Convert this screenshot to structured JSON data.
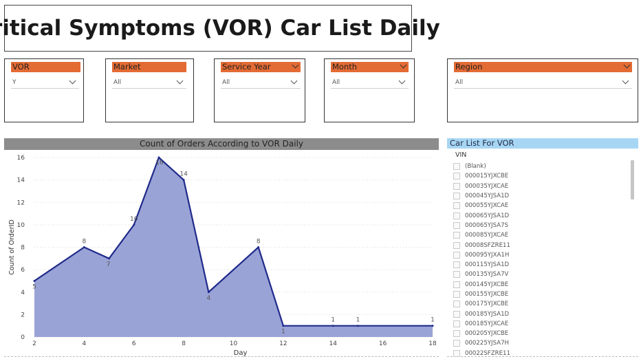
{
  "page": {
    "title": "Critical Symptoms (VOR) Car List Daily"
  },
  "slicers": [
    {
      "label": "VOR",
      "value": "Y",
      "header_chevron": false
    },
    {
      "label": "Market",
      "value": "All",
      "header_chevron": false
    },
    {
      "label": "Service Year",
      "value": "All",
      "header_chevron": true
    },
    {
      "label": "Month",
      "value": "All",
      "header_chevron": true
    },
    {
      "label": "Region",
      "value": "All",
      "header_chevron": true
    }
  ],
  "colors": {
    "header_orange": "#e36b34",
    "area_fill": "#9aa3d6",
    "area_line": "#1f2a8a",
    "list_title": "#a7d6f4"
  },
  "chart": {
    "title": "Count of Orders According to VOR Daily"
  },
  "chart_data": {
    "type": "area",
    "title": "Count of Orders According to VOR Daily",
    "xlabel": "Day",
    "ylabel": "Count of OrderID",
    "x": [
      2,
      4,
      5,
      6,
      7,
      8,
      9,
      11,
      12,
      14,
      15,
      18
    ],
    "y": [
      5,
      8,
      7,
      10,
      16,
      14,
      4,
      8,
      1,
      1,
      1,
      1
    ],
    "data_labels": [
      "5",
      "8",
      "7",
      "10",
      "16",
      "14",
      "4",
      "8",
      "1",
      "1",
      "1",
      "1"
    ],
    "xlim": [
      2,
      18
    ],
    "ylim": [
      0,
      16
    ],
    "xticks": [
      "2",
      "4",
      "6",
      "8",
      "10",
      "12",
      "14",
      "16",
      "18"
    ],
    "yticks": [
      "0",
      "2",
      "4",
      "6",
      "8",
      "10",
      "12",
      "14",
      "16"
    ],
    "grid": true
  },
  "car_list": {
    "title": "Car List For VOR",
    "column": "VIN",
    "items": [
      "(Blank)",
      "000015YJXCBE",
      "000035YJXCAE",
      "000045YJSA1D",
      "000055YJXCAE",
      "000065YJSA1D",
      "000065YJSA7S",
      "000085YJXCAE",
      "00008SFZRE11",
      "000095YJXA1H",
      "000115YJSA1D",
      "000135YJSA7V",
      "000145YJXCBE",
      "000155YJXCBE",
      "000175YJXCBE",
      "000185YJSA1D",
      "000185YJXCAE",
      "000205YJXCBE",
      "000225YJSA7H",
      "00022SFZRE11"
    ]
  }
}
